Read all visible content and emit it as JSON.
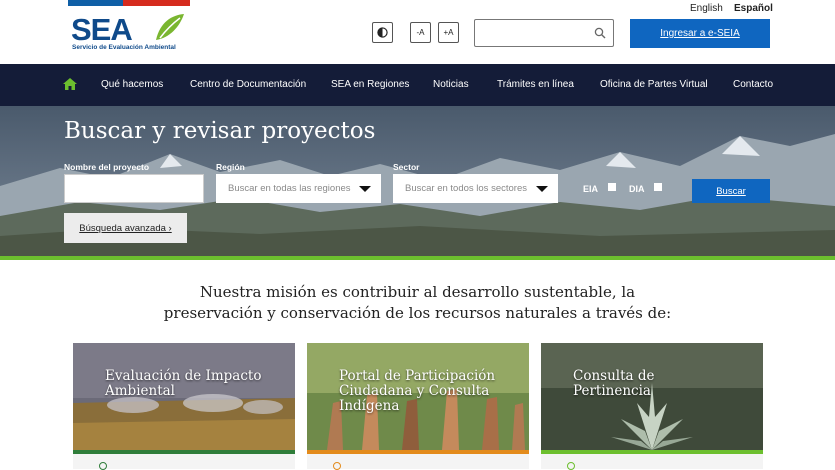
{
  "header": {
    "logo_text": "SEA",
    "logo_subtitle": "Servicio de Evaluación Ambiental",
    "lang_en": "English",
    "lang_es": "Español",
    "contrast_icon": "contrast-icon",
    "font_decrease": "-A",
    "font_increase": "+A",
    "search_placeholder": "",
    "search_icon": "search-icon",
    "eseia_button": "Ingresar a e-SEIA"
  },
  "nav": {
    "home_icon": "home-icon",
    "items": [
      "Qué hacemos",
      "Centro de Documentación",
      "SEA en Regiones",
      "Noticias",
      "Trámites en línea",
      "Oficina de Partes Virtual",
      "Contacto"
    ]
  },
  "hero": {
    "title": "Buscar y revisar proyectos",
    "project_name_label": "Nombre del proyecto",
    "project_name_value": "",
    "region_label": "Región",
    "region_value": "Buscar en todas las regiones",
    "sector_label": "Sector",
    "sector_value": "Buscar en todos los sectores",
    "eia_label": "EIA",
    "dia_label": "DIA",
    "search_button": "Buscar",
    "advanced_link": "Búsqueda avanzada ›"
  },
  "mission": {
    "line1": "Nuestra misión es contribuir al desarrollo sustentable, la",
    "line2": "preservación y conservación de los recursos naturales a través de:"
  },
  "cards": [
    {
      "title": "Evaluación de Impacto Ambiental",
      "accent": "#2f7d3a"
    },
    {
      "title": "Portal de Participación Ciudadana y Consulta Indígena",
      "accent": "#e38b1c"
    },
    {
      "title": "Consulta de Pertinencia",
      "accent": "#6cbf2e"
    }
  ],
  "colors": {
    "brand_blue": "#0f66c0",
    "nav_bg": "#141c38",
    "green": "#6cbf2e",
    "logo_blue": "#0f4a8a",
    "logo_green": "#7ab630"
  }
}
